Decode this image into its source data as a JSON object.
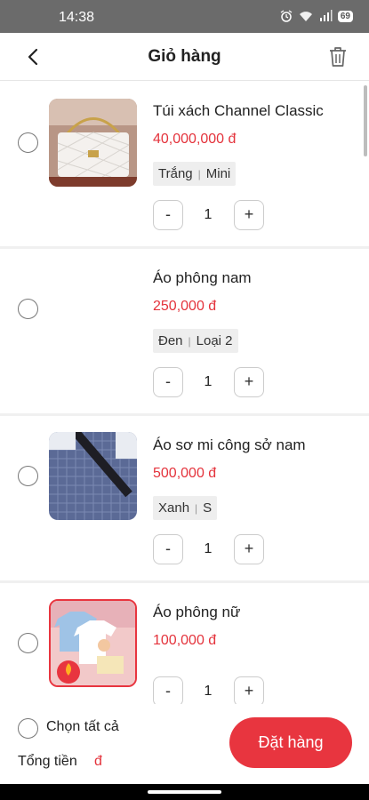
{
  "status_bar": {
    "time": "14:38",
    "battery": "69",
    "icons": [
      "alarm-icon",
      "wifi-icon",
      "signal-icon",
      "battery-icon"
    ]
  },
  "header": {
    "title": "Giỏ hàng",
    "back_icon": "back-arrow-icon",
    "delete_icon": "trash-icon"
  },
  "cart": {
    "items": [
      {
        "name": "Túi xách Channel Classic",
        "price": "40,000,000 đ",
        "variant_1": "Trắng",
        "variant_2": "Mini",
        "minus": "-",
        "qty": "1",
        "plus": "+"
      },
      {
        "name": "Áo phông nam",
        "price": "250,000 đ",
        "variant_1": "Đen",
        "variant_2": "Loại 2",
        "minus": "-",
        "qty": "1",
        "plus": "+"
      },
      {
        "name": "Áo sơ mi công sở nam",
        "price": "500,000 đ",
        "variant_1": "Xanh",
        "variant_2": "S",
        "minus": "-",
        "qty": "1",
        "plus": "+"
      },
      {
        "name": "Áo phông nữ",
        "price": "100,000 đ",
        "variant_1": "",
        "variant_2": "",
        "minus": "-",
        "qty": "1",
        "plus": "+"
      }
    ]
  },
  "footer": {
    "select_all": "Chọn tất cả",
    "total_label": "Tổng tiền",
    "total_value": "đ",
    "order_button": "Đặt hàng"
  },
  "colors": {
    "accent": "#e8353f",
    "price": "#e4333c",
    "statusbar": "#6b6b6b"
  }
}
